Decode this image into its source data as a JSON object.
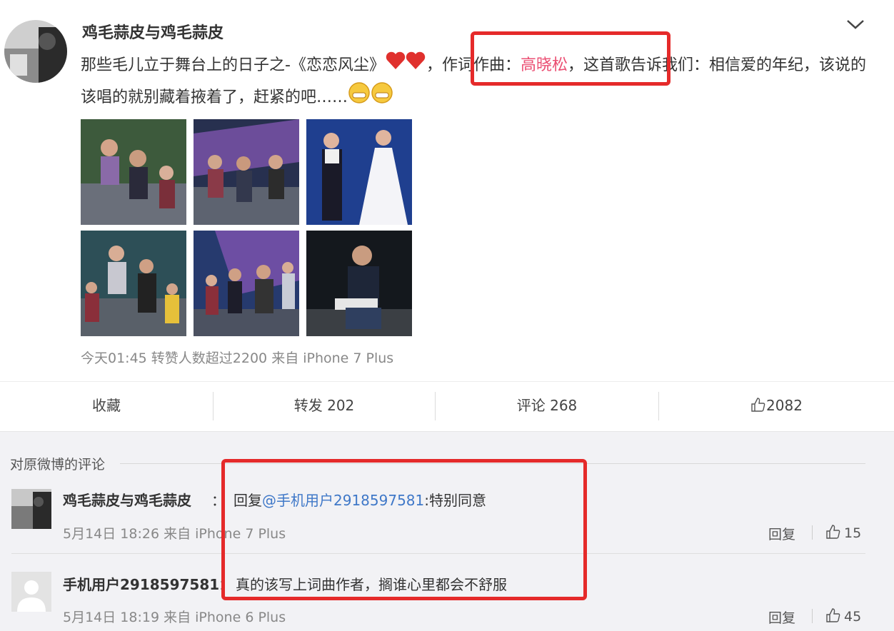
{
  "post": {
    "author": "鸡毛蒜皮与鸡毛蒜皮",
    "text_part1": "那些毛儿立于舞台上的日子之-《恋恋风尘》",
    "text_part2": "，作词作曲：",
    "text_highlight": "高晓松",
    "text_part3": "，这首歌告诉我们：相信爱的年纪，该说的该唱的就别藏着掖着了，赶紧的吧……",
    "meta": "今天01:45 转赞人数超过2200 来自 iPhone 7 Plus",
    "photos": [
      "photo-1",
      "photo-2",
      "photo-3",
      "photo-4",
      "photo-5",
      "photo-6"
    ]
  },
  "actions": {
    "favorite": "收藏",
    "repost": "转发 202",
    "comment": "评论 268",
    "like": "2082"
  },
  "comments": {
    "title": "对原微博的评论",
    "items": [
      {
        "user": "鸡毛蒜皮与鸡毛蒜皮",
        "colon": "：",
        "reply_prefix": "回复",
        "mention": "@手机用户2918597581",
        "text": ":特别同意",
        "meta": "5月14日 18:26 来自 iPhone 7 Plus",
        "reply_label": "回复",
        "likes": "15"
      },
      {
        "user": "手机用户2918597581",
        "colon": "：",
        "text": "真的该写上词曲作者，搁谁心里都会不舒服",
        "meta": "5月14日 18:19 来自 iPhone 6 Plus",
        "reply_label": "回复",
        "likes": "45"
      }
    ]
  },
  "colors": {
    "highlight_box": "#e52a2a",
    "mention_link": "#3f78c8",
    "name_highlight": "#eb4f73"
  }
}
